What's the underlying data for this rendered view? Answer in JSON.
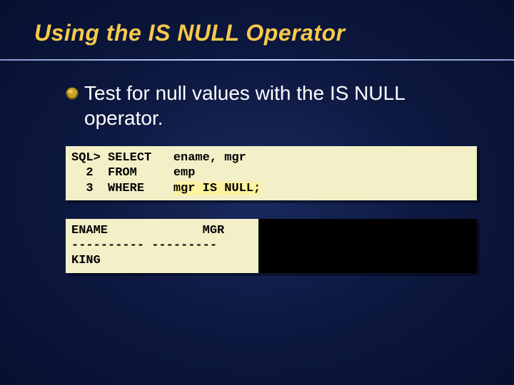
{
  "title": "Using the IS NULL Operator",
  "bullet": "Test for null values with the IS NULL operator.",
  "code1": {
    "line1_prompt": "SQL> SELECT   ",
    "line1_cols": "ename, mgr",
    "line2_prompt": "  2  FROM     ",
    "line2_table": "emp",
    "line3_prompt": "  3  WHERE    ",
    "line3_cond": "mgr IS NULL;"
  },
  "code2": {
    "line1": "ENAME             MGR",
    "line2": "---------- ---------",
    "line3": "KING"
  }
}
